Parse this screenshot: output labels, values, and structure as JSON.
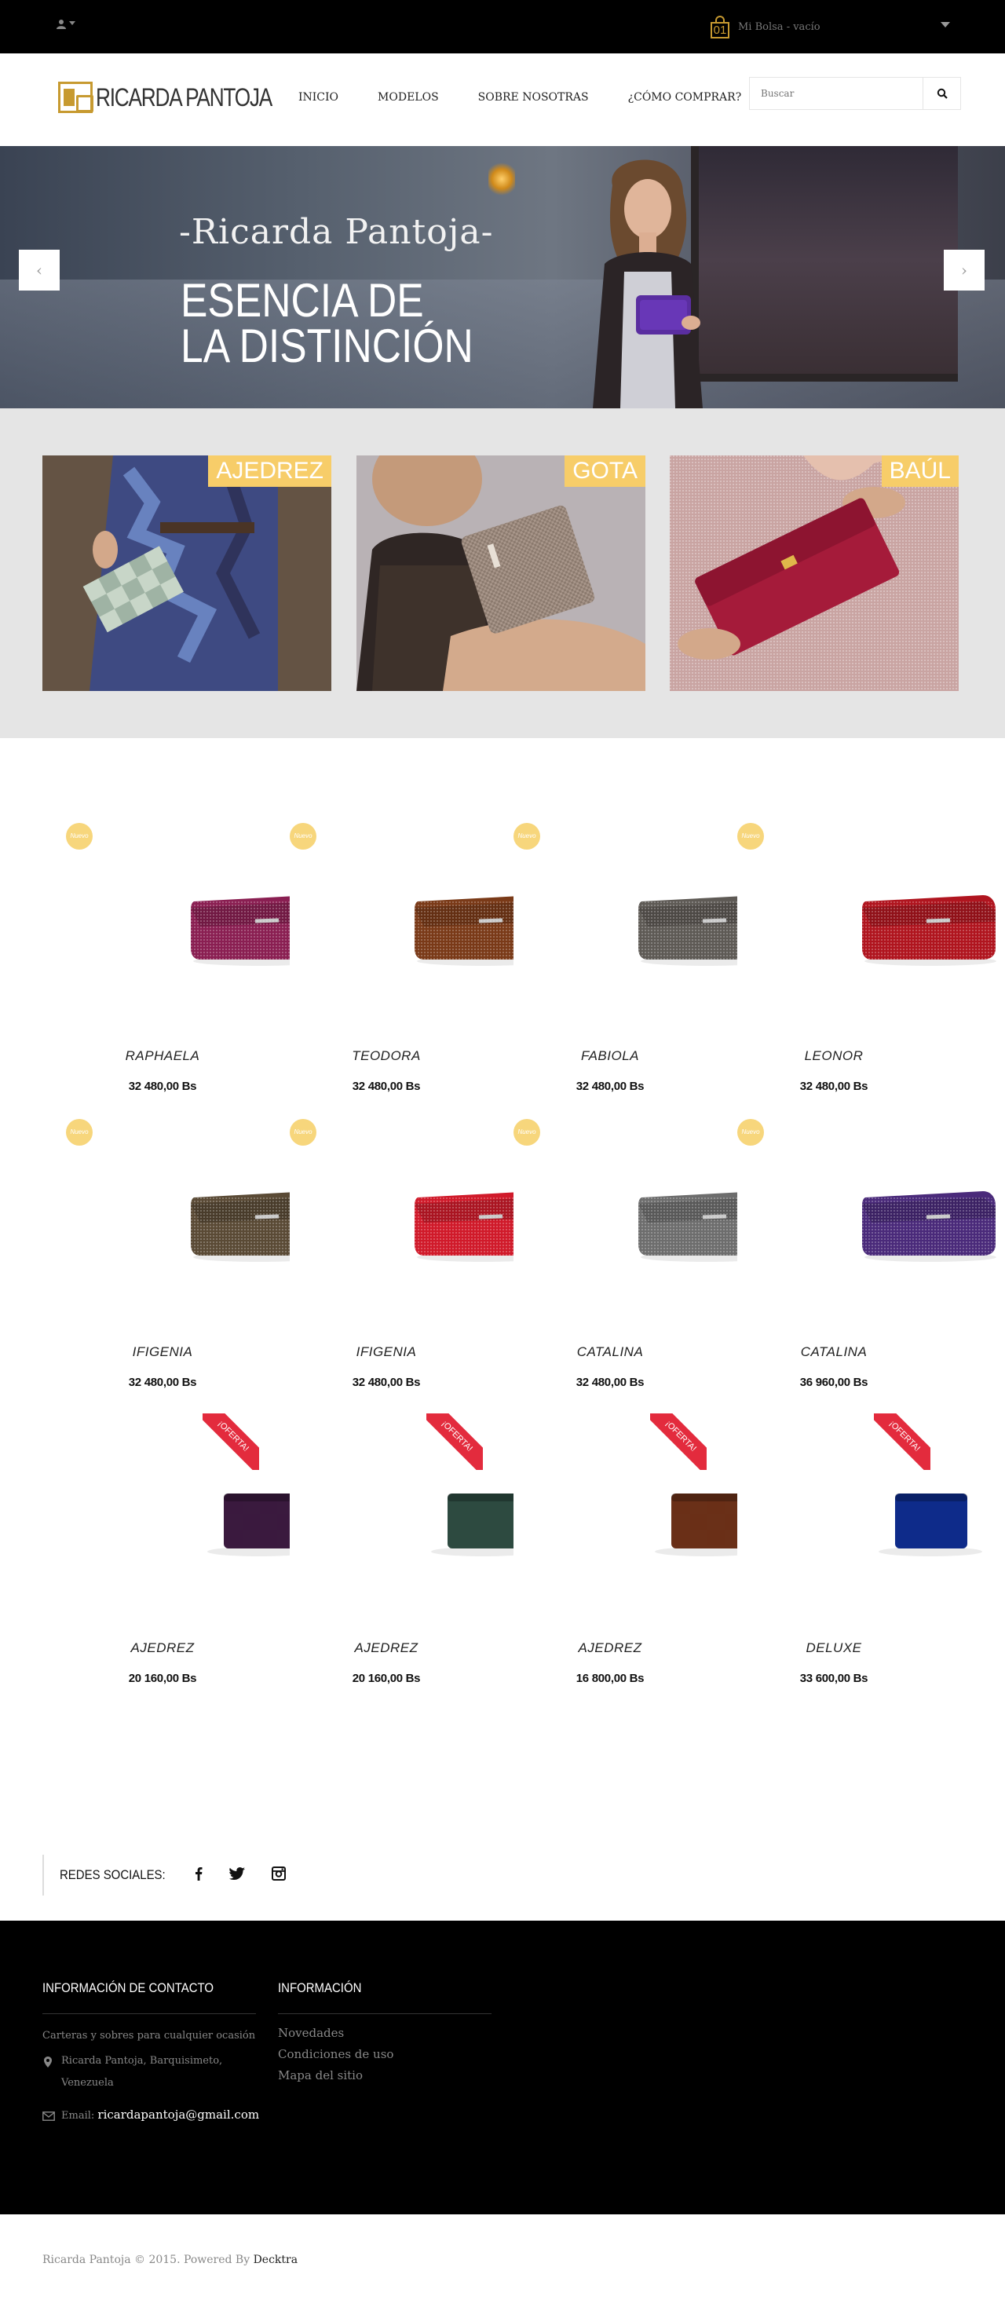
{
  "topbar": {
    "cart_count": "01",
    "cart_label": "Mi Bolsa - vacío"
  },
  "header": {
    "logo_text": "RICARDA PANTOJA",
    "nav": [
      {
        "label": "INICIO"
      },
      {
        "label": "MODELOS"
      },
      {
        "label": "SOBRE NOSOTRAS"
      },
      {
        "label": "¿CÓMO COMPRAR?"
      }
    ],
    "search_placeholder": "Buscar"
  },
  "hero": {
    "subtitle": "-Ricarda Pantoja-",
    "title": "ESENCIA DE LA DISTINCIÓN"
  },
  "categories": [
    {
      "label": "AJEDREZ"
    },
    {
      "label": "GOTA"
    },
    {
      "label": "BAÚL"
    }
  ],
  "badges": {
    "new": "Nuevo",
    "sale": "¡OFERTA!"
  },
  "products": [
    {
      "name": "RAPHAELA",
      "price": "32 480,00 Bs",
      "badge": "new",
      "color": "#8a1f52"
    },
    {
      "name": "TEODORA",
      "price": "32 480,00 Bs",
      "badge": "new",
      "color": "#7a3a18"
    },
    {
      "name": "FABIOLA",
      "price": "32 480,00 Bs",
      "badge": "new",
      "color": "#5e5a55"
    },
    {
      "name": "LEONOR",
      "price": "32 480,00 Bs",
      "badge": "new",
      "color": "#b0151f"
    },
    {
      "name": "IFIGENIA",
      "price": "32 480,00 Bs",
      "badge": "new",
      "color": "#5a4a35"
    },
    {
      "name": "IFIGENIA",
      "price": "32 480,00 Bs",
      "badge": "new",
      "color": "#d01a2a"
    },
    {
      "name": "CATALINA",
      "price": "32 480,00 Bs",
      "badge": "new",
      "color": "#6d6d6d"
    },
    {
      "name": "CATALINA",
      "price": "36 960,00 Bs",
      "badge": "new",
      "color": "#4a2a7a"
    },
    {
      "name": "AJEDREZ",
      "price": "20 160,00 Bs",
      "badge": "sale",
      "color": "#3a1a3e"
    },
    {
      "name": "AJEDREZ",
      "price": "20 160,00 Bs",
      "badge": "sale",
      "color": "#2d4a40"
    },
    {
      "name": "AJEDREZ",
      "price": "16 800,00 Bs",
      "badge": "sale",
      "color": "#6a3018"
    },
    {
      "name": "DELUXE",
      "price": "33 600,00 Bs",
      "badge": "sale",
      "color": "#0e2b8a"
    }
  ],
  "social": {
    "label": "REDES SOCIALES:"
  },
  "footer": {
    "contact_title": "INFORMACIÓN DE CONTACTO",
    "contact_tagline": "Carteras y sobres para cualquier ocasión",
    "contact_address_line1": "Ricarda Pantoja, Barquisimeto,",
    "contact_address_line2": "Venezuela",
    "email_label": "Email:",
    "email_value": "ricardapantoja@gmail.com",
    "info_title": "INFORMACIÓN",
    "info_links": [
      "Novedades",
      "Condiciones de uso",
      "Mapa del sitio"
    ],
    "copyright": "Ricarda Pantoja © 2015. Powered By",
    "powered_by": "Decktra"
  },
  "colors": {
    "accent_gold": "#f7cd69",
    "sale_red": "#e32b3d",
    "topbar_bg": "#000000"
  }
}
